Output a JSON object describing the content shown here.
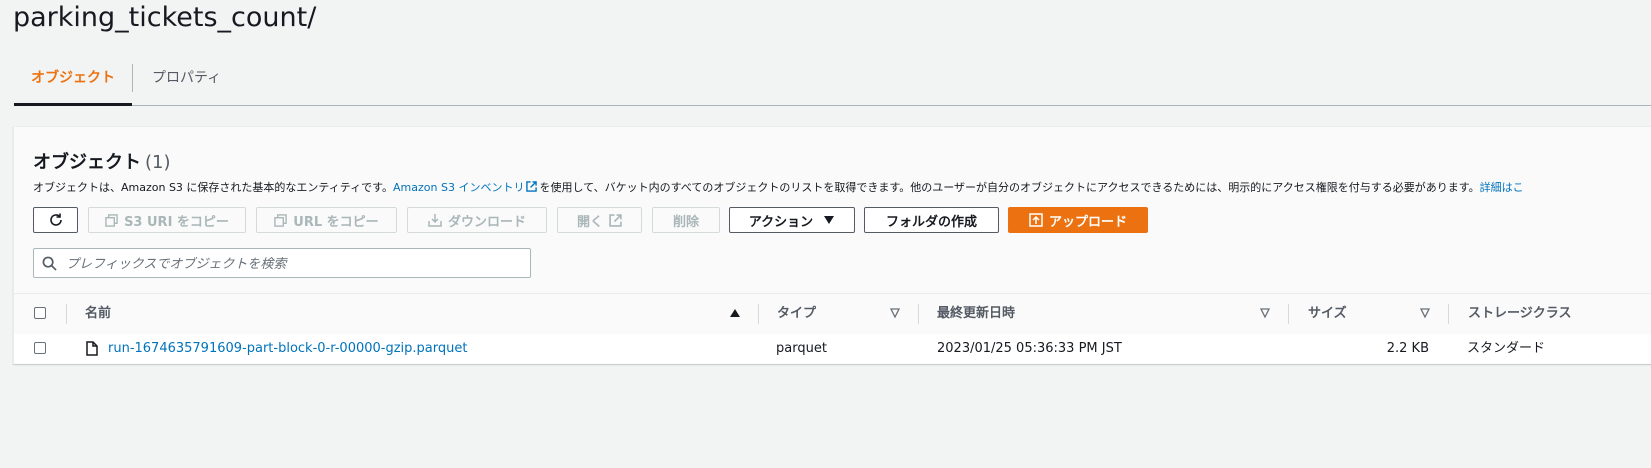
{
  "page": {
    "title": "parking_tickets_count/"
  },
  "tabs": [
    {
      "label": "オブジェクト",
      "active": true
    },
    {
      "label": "プロパティ",
      "active": false
    }
  ],
  "section": {
    "title": "オブジェクト",
    "count": "(1)",
    "description_before": "オブジェクトは、Amazon S3 に保存された基本的なエンティティです。",
    "description_link": "Amazon S3 インベントリ",
    "description_after": "を使用して、バケット内のすべてのオブジェクトのリストを取得できます。他のユーザーが自分のオブジェクトにアクセスできるためには、明示的にアクセス権限を付与する必要があります。",
    "learn_more": "詳細はこ"
  },
  "toolbar": {
    "copy_s3_uri": "S3 URI をコピー",
    "copy_url": "URL をコピー",
    "download": "ダウンロード",
    "open": "開く",
    "delete": "削除",
    "actions": "アクション",
    "create_folder": "フォルダの作成",
    "upload": "アップロード"
  },
  "search": {
    "placeholder": "プレフィックスでオブジェクトを検索",
    "value": ""
  },
  "table": {
    "columns": [
      "名前",
      "タイプ",
      "最終更新日時",
      "サイズ",
      "ストレージクラス"
    ],
    "rows": [
      {
        "name": "run-1674635791609-part-block-0-r-00000-gzip.parquet",
        "type": "parquet",
        "last_modified": "2023/01/25 05:36:33 PM JST",
        "size": "2.2 KB",
        "storage_class": "スタンダード"
      }
    ]
  },
  "colors": {
    "accent": "#ec7211",
    "link": "#0073bb",
    "text": "#16191f",
    "muted": "#545b64"
  },
  "icons": [
    "refresh-icon",
    "copy-icon",
    "download-icon",
    "external-link-icon",
    "caret-down-icon",
    "upload-icon",
    "search-icon",
    "file-icon",
    "sort-asc-icon",
    "sort-desc-icon"
  ]
}
